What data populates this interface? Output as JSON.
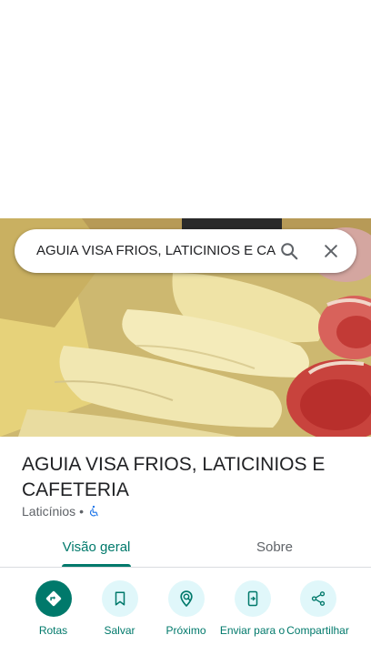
{
  "search": {
    "query": "AGUIA VISA FRIOS, LATICINIOS E CA",
    "search_icon": "search-icon",
    "close_icon": "close-icon"
  },
  "place": {
    "title": "AGUIA VISA FRIOS, LATICINIOS E CAFETERIA",
    "category": "Laticínios",
    "separator": "•",
    "accessibility_icon": "wheelchair-icon"
  },
  "tabs": [
    {
      "label": "Visão geral",
      "selected": true
    },
    {
      "label": "Sobre",
      "selected": false
    }
  ],
  "actions": [
    {
      "label": "Rotas",
      "icon": "directions-icon"
    },
    {
      "label": "Salvar",
      "icon": "bookmark-icon"
    },
    {
      "label": "Próximo",
      "icon": "nearby-icon"
    },
    {
      "label": "Enviar para o",
      "icon": "send-to-phone-icon"
    },
    {
      "label": "Compartilhar",
      "icon": "share-icon"
    }
  ],
  "colors": {
    "accent": "#00796b",
    "action_bg": "#e0f7fa",
    "text_primary": "#202124",
    "text_secondary": "#5f6368"
  }
}
